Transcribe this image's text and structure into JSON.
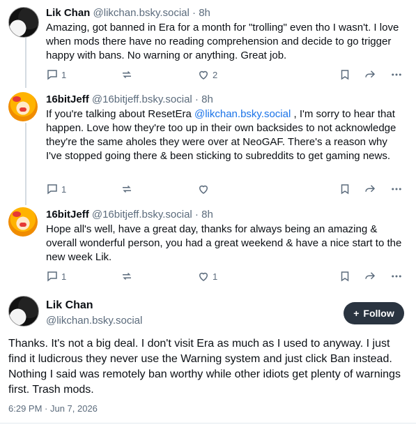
{
  "replies": [
    {
      "name": "Lik Chan",
      "handle": "@likchan.bsky.social",
      "time": "8h",
      "text": "Amazing, got banned in Era for a month for \"trolling\" even tho I wasn't.  I love when mods there have no reading comprehension and decide to go trigger happy with bans. No warning or anything. Great job.",
      "reply_count": "1",
      "repost_count": "",
      "like_count": "2"
    },
    {
      "name": "16bitJeff",
      "handle": "@16bitjeff.bsky.social",
      "time": "8h",
      "text_before": "If you're talking about ResetEra ",
      "mention": "@likchan.bsky.social",
      "text_after": " , I'm sorry to hear that happen.  Love how they're too up in their own backsides to not acknowledge they're the same aholes they were over at NeoGAF. There's a reason why I've stopped going there & been sticking to subreddits to get gaming news.",
      "reply_count": "1",
      "repost_count": "",
      "like_count": ""
    },
    {
      "name": "16bitJeff",
      "handle": "@16bitjeff.bsky.social",
      "time": "8h",
      "text": "Hope all's well, have a great day, thanks for always being an amazing & overall wonderful person, you had a great weekend & have a nice start to the new week Lik.",
      "reply_count": "1",
      "repost_count": "",
      "like_count": "1"
    }
  ],
  "main_post": {
    "name": "Lik Chan",
    "handle": "@likchan.bsky.social",
    "follow_label": "Follow",
    "text": "Thanks. It's not a big deal. I don't visit Era as much as I used to anyway. I just find it ludicrous they never use the Warning system and just click Ban instead. Nothing I said was remotely ban worthy while other idiots get plenty of warnings first. Trash mods.",
    "timestamp": "6:29 PM · Jun 7, 2026"
  },
  "separator": " · ",
  "colors": {
    "accent": "#1a73e8",
    "muted": "#5b6b7c",
    "follow_bg": "#2a3440"
  },
  "icons": [
    "reply-icon",
    "repost-icon",
    "like-icon",
    "bookmark-icon",
    "share-icon",
    "more-icon",
    "plus-icon"
  ]
}
